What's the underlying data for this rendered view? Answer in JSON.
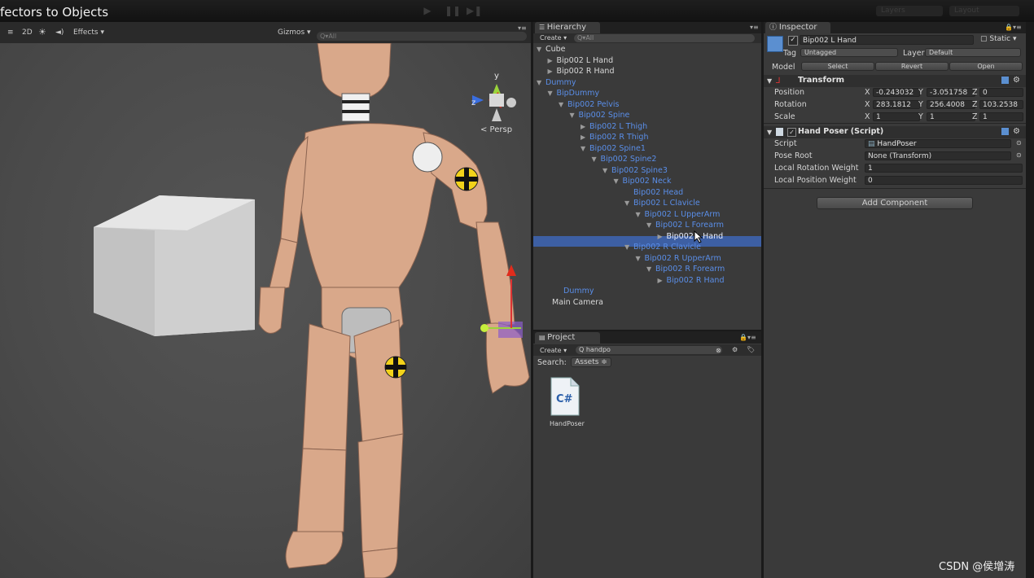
{
  "window": {
    "title": "fectors to Objects"
  },
  "toolbar": {
    "play": "▶",
    "pause": "❚❚",
    "step": "▶❚",
    "layers": "Layers",
    "layout": "Layout"
  },
  "scene": {
    "tools": {
      "shaded": "≡",
      "mode2d": "2D",
      "lighting": "☀",
      "audio": "◄)",
      "effects": "Effects ▾",
      "gizmos": "Gizmos ▾",
      "search_placeholder": "Q▾All"
    },
    "persp_label": "< Persp",
    "gizmo_axes": {
      "y": "y",
      "z": "z"
    }
  },
  "hierarchy": {
    "tab": "Hierarchy",
    "create": "Create ▾",
    "search_placeholder": "Q▾All",
    "items": [
      {
        "label": "Cube",
        "color": "white",
        "tri": "▼"
      },
      {
        "label": "Bip002 L Hand",
        "color": "white",
        "tri": "▶"
      },
      {
        "label": "Bip002 R Hand",
        "color": "white",
        "tri": "▶"
      },
      {
        "label": "Dummy",
        "color": "blue",
        "tri": "▼"
      },
      {
        "label": "BipDummy",
        "color": "blue",
        "tri": "▼"
      },
      {
        "label": "Bip002 Pelvis",
        "color": "blue",
        "tri": "▼"
      },
      {
        "label": "Bip002 Spine",
        "color": "blue",
        "tri": "▼"
      },
      {
        "label": "Bip002 L Thigh",
        "color": "blue",
        "tri": "▶"
      },
      {
        "label": "Bip002 R Thigh",
        "color": "blue",
        "tri": "▶"
      },
      {
        "label": "Bip002 Spine1",
        "color": "blue",
        "tri": "▼"
      },
      {
        "label": "Bip002 Spine2",
        "color": "blue",
        "tri": "▼"
      },
      {
        "label": "Bip002 Spine3",
        "color": "blue",
        "tri": "▼"
      },
      {
        "label": "Bip002 Neck",
        "color": "blue",
        "tri": "▼"
      },
      {
        "label": "Bip002 Head",
        "color": "blue",
        "tri": ""
      },
      {
        "label": "Bip002 L Clavicle",
        "color": "blue",
        "tri": "▼"
      },
      {
        "label": "Bip002 L UpperArm",
        "color": "blue",
        "tri": "▼"
      },
      {
        "label": "Bip002 L Forearm",
        "color": "blue",
        "tri": "▼"
      },
      {
        "label": "Bip002 L Hand",
        "color": "selected",
        "tri": "▶"
      },
      {
        "label": "Bip002 R Clavicle",
        "color": "blue",
        "tri": "▼"
      },
      {
        "label": "Bip002 R UpperArm",
        "color": "blue",
        "tri": "▼"
      },
      {
        "label": "Bip002 R Forearm",
        "color": "blue",
        "tri": "▼"
      },
      {
        "label": "Bip002 R Hand",
        "color": "blue",
        "tri": "▶"
      },
      {
        "label": "Dummy",
        "color": "blue",
        "tri": ""
      },
      {
        "label": "Main Camera",
        "color": "white",
        "tri": ""
      }
    ]
  },
  "project": {
    "tab": "Project",
    "create": "Create ▾",
    "search_value": "Q handpo",
    "search_label": "Search:",
    "scope": "Assets ≑",
    "asset": {
      "name": "HandPoser",
      "icon_text": "C#"
    }
  },
  "inspector": {
    "tab": "Inspector",
    "object_name": "Bip002 L Hand",
    "static_label": "Static",
    "tag_label": "Tag",
    "tag_value": "Untagged",
    "layer_label": "Layer",
    "layer_value": "Default",
    "model_label": "Model",
    "model_buttons": [
      "Select",
      "Revert",
      "Open"
    ],
    "transform": {
      "title": "Transform",
      "rows": [
        {
          "label": "Position",
          "x": "-0.243032",
          "y": "-3.051758",
          "z": "0"
        },
        {
          "label": "Rotation",
          "x": "283.1812",
          "y": "256.4008",
          "z": "103.2538"
        },
        {
          "label": "Scale",
          "x": "1",
          "y": "1",
          "z": "1"
        }
      ],
      "axis_x": "X",
      "axis_y": "Y",
      "axis_z": "Z"
    },
    "script_component": {
      "title": "Hand Poser (Script)",
      "script_label": "Script",
      "script_value": "HandPoser",
      "pose_root_label": "Pose Root",
      "pose_root_value": "None (Transform)",
      "rot_weight_label": "Local Rotation Weight",
      "rot_weight_value": "1",
      "pos_weight_label": "Local Position Weight",
      "pos_weight_value": "0"
    },
    "add_component": "Add Component"
  },
  "watermark": "CSDN @侯增涛",
  "colors": {
    "selection": "#3d5fa3",
    "blue_text": "#5a8ee8",
    "panel_bg": "#3a3a3a"
  }
}
